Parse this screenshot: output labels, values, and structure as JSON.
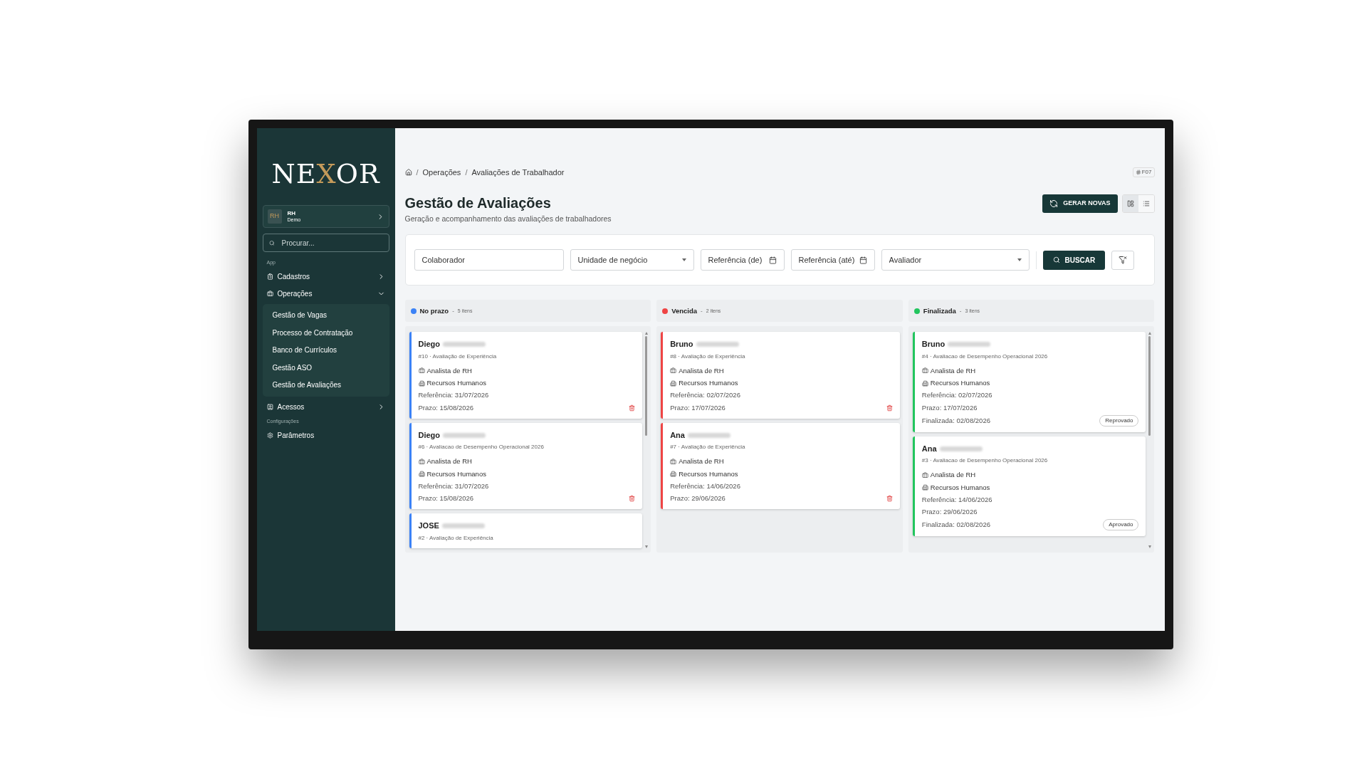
{
  "logo": {
    "start": "NE",
    "accent": "X",
    "end": "OR"
  },
  "workspace": {
    "initials": "RH",
    "name": "RH",
    "subtitle": "Demo"
  },
  "search": {
    "placeholder": "Procurar..."
  },
  "sidebar": {
    "sections": [
      {
        "label": "App",
        "items": [
          {
            "label": "Cadastros",
            "kind": "group",
            "expanded": false
          },
          {
            "label": "Operações",
            "kind": "group",
            "expanded": true,
            "children": [
              {
                "label": "Gestão de Vagas"
              },
              {
                "label": "Processo de Contratação"
              },
              {
                "label": "Banco de Currículos"
              },
              {
                "label": "Gestão ASO"
              },
              {
                "label": "Gestão de Avaliações"
              }
            ]
          },
          {
            "label": "Acessos",
            "kind": "group",
            "expanded": false
          }
        ]
      },
      {
        "label": "Configurações",
        "items": [
          {
            "label": "Parâmetros",
            "kind": "link"
          }
        ]
      }
    ]
  },
  "breadcrumb": [
    {
      "separator": "/",
      "label": "Operações"
    },
    {
      "separator": "/",
      "label": "Avaliações de Trabalhador"
    }
  ],
  "page_code": "F07",
  "title": "Gestão de Avaliações",
  "subtitle": "Geração e acompanhamento das avaliações de trabalhadores",
  "generate_button": "GERAR NOVAS",
  "view_toggle": [
    {
      "kind": "board",
      "selected": true
    },
    {
      "kind": "list",
      "selected": false
    }
  ],
  "filters": [
    {
      "kind": "text",
      "placeholder": "Colaborador"
    },
    {
      "kind": "select",
      "placeholder": "Unidade de negócio"
    },
    {
      "kind": "date",
      "placeholder": "Referência (de)"
    },
    {
      "kind": "date",
      "placeholder": "Referência (até)"
    },
    {
      "kind": "select",
      "placeholder": "Avaliador"
    }
  ],
  "search_button": "BUSCAR",
  "columns": [
    {
      "title": "No prazo",
      "separator": "-",
      "count": "5 itens",
      "color": "#3b82f6",
      "scrollbar": true,
      "cards": [
        {
          "name": "Diego",
          "code": "#10 · Avaliação de Experiência",
          "role": "Analista de RH",
          "department": "Recursos Humanos",
          "reference": "Referência: 31/07/2026",
          "deadline": "Prazo: 15/08/2026",
          "deletable": true
        },
        {
          "name": "Diego",
          "code": "#6 · Avaliacao de Desempenho Operacional 2026",
          "role": "Analista de RH",
          "department": "Recursos Humanos",
          "reference": "Referência: 31/07/2026",
          "deadline": "Prazo: 15/08/2026",
          "deletable": true
        },
        {
          "name": "JOSE",
          "code": "#2 · Avaliação de Experiência",
          "deletable": false
        }
      ]
    },
    {
      "title": "Vencida",
      "separator": "-",
      "count": "2 itens",
      "color": "#ef4444",
      "scrollbar": false,
      "cards": [
        {
          "name": "Bruno",
          "code": "#8 · Avaliação de Experiência",
          "role": "Analista de RH",
          "department": "Recursos Humanos",
          "reference": "Referência: 02/07/2026",
          "deadline": "Prazo: 17/07/2026",
          "deletable": true
        },
        {
          "name": "Ana",
          "code": "#7 · Avaliação de Experiência",
          "role": "Analista de RH",
          "department": "Recursos Humanos",
          "reference": "Referência: 14/06/2026",
          "deadline": "Prazo: 29/06/2026",
          "deletable": true
        }
      ]
    },
    {
      "title": "Finalizada",
      "separator": "-",
      "count": "3 itens",
      "color": "#22c55e",
      "scrollbar": true,
      "cards": [
        {
          "name": "Bruno",
          "code": "#4 · Avaliacao de Desempenho Operacional 2026",
          "role": "Analista de RH",
          "department": "Recursos Humanos",
          "reference": "Referência: 02/07/2026",
          "deadline": "Prazo: 17/07/2026",
          "finished": "Finalizada: 02/08/2026",
          "result": "Reprovado",
          "deletable": false
        },
        {
          "name": "Ana",
          "code": "#3 · Avaliacao de Desempenho Operacional 2026",
          "role": "Analista de RH",
          "department": "Recursos Humanos",
          "reference": "Referência: 14/06/2026",
          "deadline": "Prazo: 29/06/2026",
          "finished": "Finalizada: 02/08/2026",
          "result": "Aprovado",
          "deletable": false
        }
      ]
    }
  ]
}
